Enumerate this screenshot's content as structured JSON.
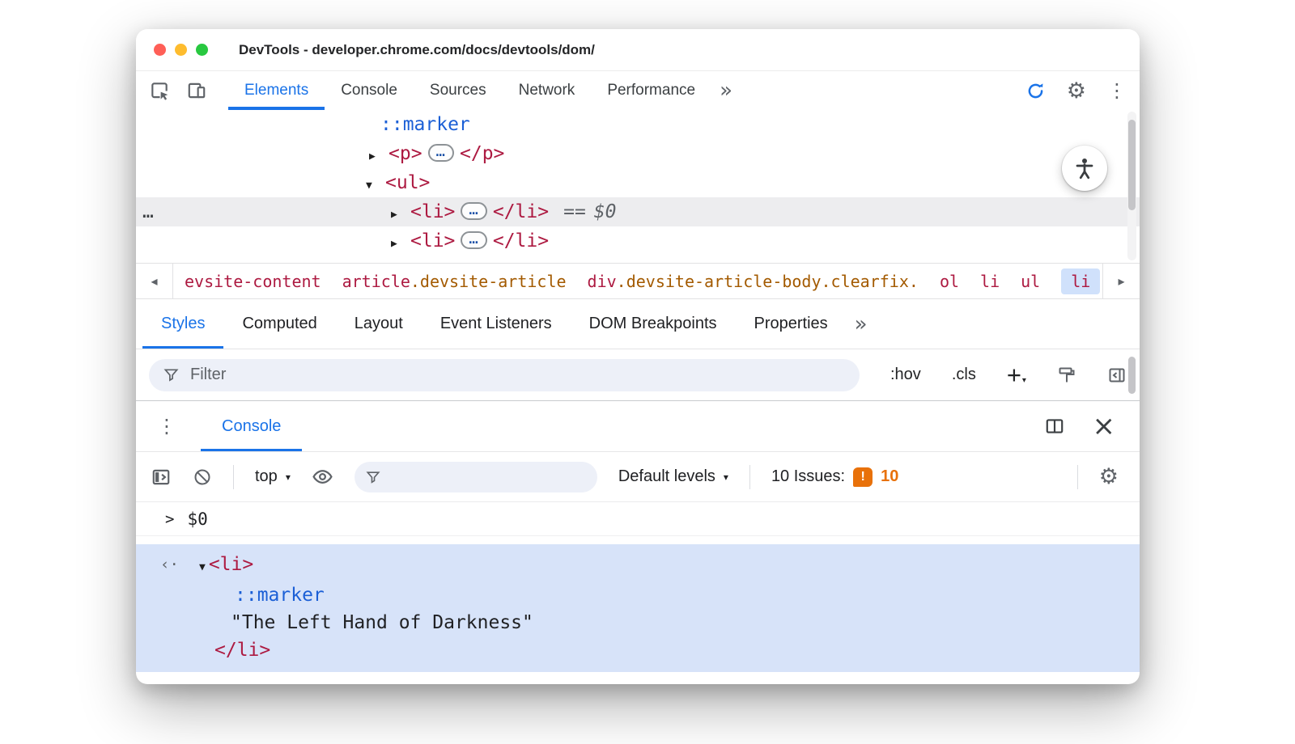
{
  "colors": {
    "accent": "#1a73e8",
    "tag": "#ad1a41",
    "attr": "#a35a00",
    "pseudo": "#1b5fd6",
    "muted": "#5f6368",
    "issue": "#e8710a",
    "input-bg": "#edf0f8",
    "result-bg": "#d7e3f9",
    "crumb-selected-bg": "#d0e1fb",
    "row-selected-bg": "#ededef",
    "traffic-red": "#ff5f57",
    "traffic-yellow": "#febc2e",
    "traffic-green": "#28c840"
  },
  "icons": {
    "gear": "⚙",
    "kebab": "⋮",
    "more": "»",
    "close": "×",
    "back": "◂",
    "forward": "▸",
    "caret": "▾"
  },
  "window": {
    "title": "DevTools - developer.chrome.com/docs/devtools/dom/"
  },
  "toolbar": {
    "tabs": [
      "Elements",
      "Console",
      "Sources",
      "Network",
      "Performance"
    ]
  },
  "tree": {
    "gutter": "…",
    "marker": "::marker",
    "p": {
      "arrow": "▶",
      "open": "<p>",
      "dots": "…",
      "close": "</p>"
    },
    "ul": {
      "arrow": "▼",
      "open": "<ul>"
    },
    "li1": {
      "arrow": "▶",
      "open": "<li>",
      "dots": "…",
      "close": "</li>",
      "eq": "==",
      "ref": "$0"
    },
    "li2": {
      "arrow": "▶",
      "open": "<li>",
      "dots": "…",
      "close": "</li>"
    }
  },
  "crumbs": {
    "c1": "evsite-content",
    "c2_tag": "article",
    "c2_cls": ".devsite-article",
    "c3_tag": "div",
    "c3_cls": ".devsite-article-body.clearfix.",
    "c4": "ol",
    "c5": "li",
    "c6": "ul",
    "c7": "li"
  },
  "subtabs": {
    "items": [
      "Styles",
      "Computed",
      "Layout",
      "Event Listeners",
      "DOM Breakpoints",
      "Properties"
    ]
  },
  "stylesbar": {
    "filter_placeholder": "Filter",
    "hov": ":hov",
    "cls": ".cls",
    "plus": "+"
  },
  "consolePanel": {
    "tab": "Console",
    "context": "top",
    "levels": "Default levels",
    "issues_label": "10 Issues:",
    "issues_mark": "!",
    "issues_count": "10",
    "prompt": ">",
    "prompt_value": "$0",
    "result_arrow": "‹·",
    "li_arrow": "▼",
    "li_open": "<li>",
    "marker": "::marker",
    "string": "\"The Left Hand of Darkness\"",
    "li_close": "</li>"
  }
}
